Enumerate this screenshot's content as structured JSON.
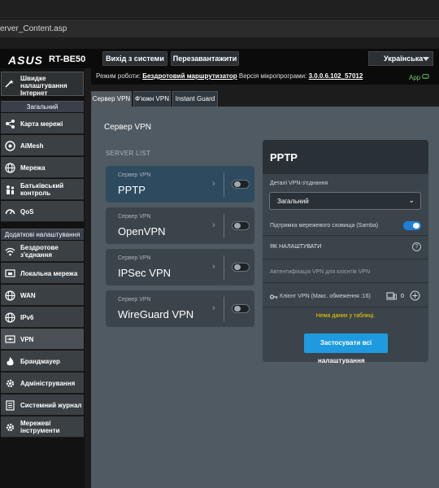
{
  "browser": {
    "url_fragment": "erver_Content.asp"
  },
  "header": {
    "brand": "ASUS",
    "model": "RT-BE50",
    "logout_label": "Вихід з системи",
    "reboot_label": "Перезавантажити",
    "language": "Українська"
  },
  "status_bar": {
    "mode_label": "Режим роботи:",
    "mode_value": "Бездротовий маршрутизатор",
    "firmware_label": "Версія мікропрограми:",
    "firmware_value": "3.0.0.6.102_57012",
    "app_label": "App"
  },
  "sidebar": {
    "quick_setup": "Швидке налаштування Інтернет",
    "general_header": "Загальний",
    "general_items": [
      "Карта мережі",
      "AiMesh",
      "Мережа",
      "Батьківський контроль",
      "QoS"
    ],
    "advanced_header": "Додаткові налаштування",
    "advanced_items": [
      "Бездротове з'єднання",
      "Локальна мережа",
      "WAN",
      "IPv6",
      "VPN",
      "Брандмауер",
      "Адміністрування",
      "Системний журнал",
      "Мережеві інструменти"
    ]
  },
  "tabs": [
    "Сервер VPN",
    "Ф'южн VPN",
    "Instant Guard"
  ],
  "main": {
    "title": "Сервер VPN",
    "server_list_header": "SERVER LIST",
    "server_sub": "Сервер VPN",
    "servers": [
      {
        "name": "PPTP",
        "enabled": false
      },
      {
        "name": "OpenVPN",
        "enabled": false
      },
      {
        "name": "IPSec VPN",
        "enabled": false
      },
      {
        "name": "WireGuard VPN",
        "enabled": false
      }
    ]
  },
  "details": {
    "title": "PPTP",
    "conn_details_label": "Деталі VPN-з'єднання",
    "conn_details_value": "Загальний",
    "samba_label": "Підтримка мережевого сховища (Samba)",
    "samba_enabled": true,
    "howto_label": "ЯК НАЛАШТУВАТИ",
    "auth_label": "Автентифікація VPN для клієнтів VPN",
    "clients_label": "Клієнт VPN (Макс. обмеження :16)",
    "clients_count": "0",
    "no_data": "Нема даних у таблиці.",
    "apply_label": "Застосувати всі",
    "apply_cont": "налаштування"
  }
}
